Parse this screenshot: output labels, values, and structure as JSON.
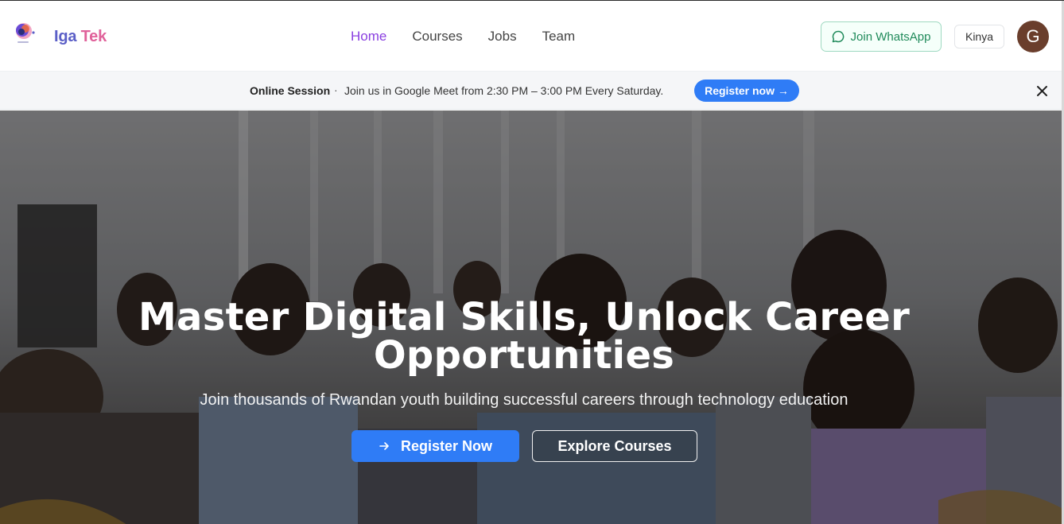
{
  "header": {
    "brand_part1": "Iga",
    "brand_part2": " Tek",
    "logo_icon": "iga-tek-logo",
    "nav": [
      {
        "label": "Home",
        "active": true
      },
      {
        "label": "Courses",
        "active": false
      },
      {
        "label": "Jobs",
        "active": false
      },
      {
        "label": "Team",
        "active": false
      }
    ],
    "whatsapp_label": "Join WhatsApp",
    "whatsapp_icon": "chat-bubble-icon",
    "language_label": "Kinya",
    "avatar_initial": "G"
  },
  "banner": {
    "title": "Online Session",
    "separator": "·",
    "message": "Join us in Google Meet from 2:30 PM – 3:00 PM Every Saturday.",
    "button_label": "Register now →",
    "close_icon": "close-icon"
  },
  "hero": {
    "title_line1": "Master Digital Skills, Unlock Career",
    "title_line2": "Opportunities",
    "subtitle": "Join thousands of Rwandan youth building successful careers through technology education",
    "primary_label": "Register Now",
    "primary_icon": "arrow-right-icon",
    "secondary_label": "Explore Courses"
  },
  "colors": {
    "accent": "#2f7cf6",
    "nav_active": "#8a3fe0",
    "whatsapp": "#1f8a5a",
    "brand_blue": "#5b5fc7",
    "brand_pink": "#e0619a"
  }
}
